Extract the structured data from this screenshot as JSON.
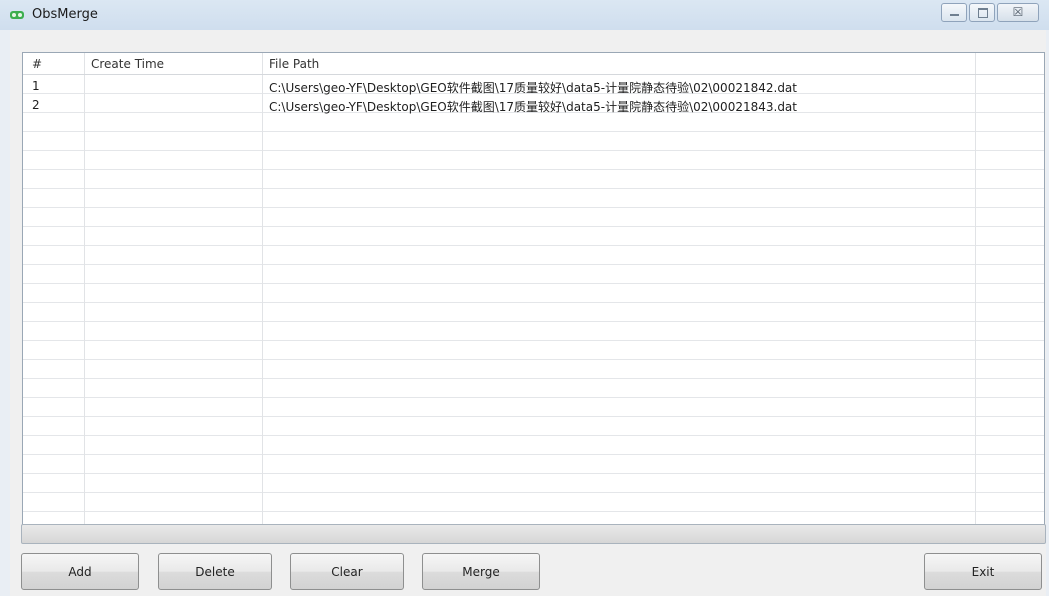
{
  "window": {
    "title": "ObsMerge",
    "buttons": {
      "minimize": "minimize-icon",
      "maximize": "maximize-icon",
      "close_glyph": "☒"
    }
  },
  "table": {
    "columns": [
      "#",
      "Create Time",
      "File Path"
    ],
    "rows": [
      {
        "index": "1",
        "create_time": "",
        "file_path": "C:\\Users\\geo-YF\\Desktop\\GEO软件截图\\17质量较好\\data5-计量院静态待验\\02\\00021842.dat"
      },
      {
        "index": "2",
        "create_time": "",
        "file_path": "C:\\Users\\geo-YF\\Desktop\\GEO软件截图\\17质量较好\\data5-计量院静态待验\\02\\00021843.dat"
      }
    ]
  },
  "progress": {
    "value": 0
  },
  "toolbar": {
    "add_label": "Add",
    "delete_label": "Delete",
    "clear_label": "Clear",
    "merge_label": "Merge",
    "exit_label": "Exit"
  },
  "colors": {
    "accent_icon": "#3cae4f",
    "frame_bg": "#e9eef4"
  }
}
